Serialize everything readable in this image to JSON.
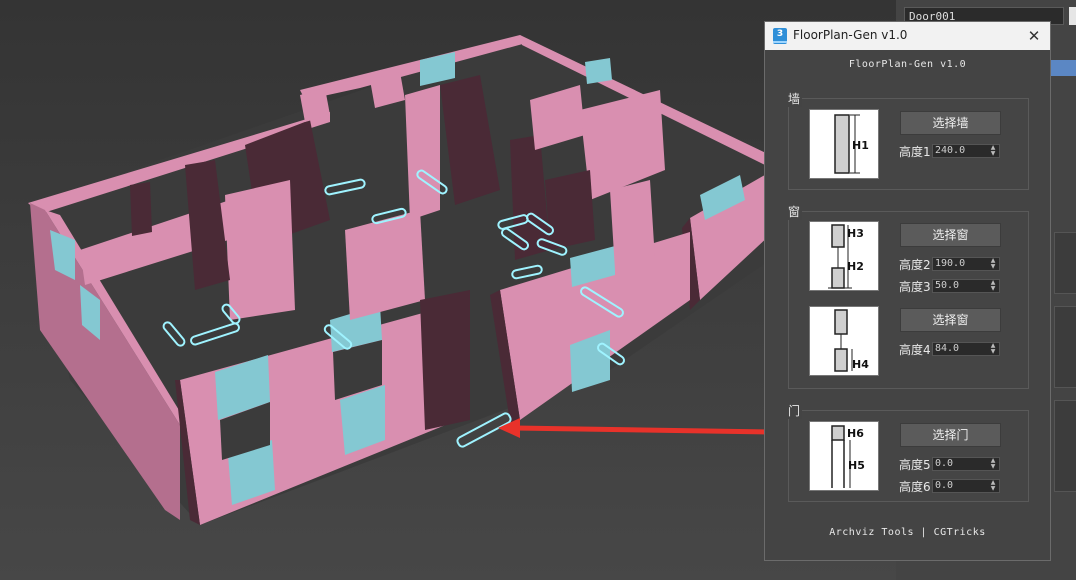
{
  "app": {
    "object_name": "Door001"
  },
  "dialog": {
    "title": "FloorPlan-Gen v1.0",
    "close_symbol": "✕",
    "icon_name": "3dsmax-app-icon",
    "header": "FloorPlan-Gen v1.0",
    "footer": "Archviz Tools | CGTricks",
    "wall": {
      "label": "墙",
      "button": "选择墙",
      "height1_label": "高度1",
      "height1_value": "240.0",
      "thumb_label": "H1"
    },
    "window": {
      "label": "窗",
      "button1": "选择窗",
      "height2_label": "高度2",
      "height2_value": "190.0",
      "height3_label": "高度3",
      "height3_value": "50.0",
      "thumb1_labels": [
        "H3",
        "H2"
      ],
      "button2": "选择窗",
      "height4_label": "高度4",
      "height4_value": "84.0",
      "thumb2_label": "H4"
    },
    "door": {
      "label": "门",
      "button": "选择门",
      "height5_label": "高度5",
      "height5_value": "0.0",
      "height6_label": "高度6",
      "height6_value": "0.0",
      "thumb_labels": [
        "H6",
        "H5"
      ]
    }
  },
  "annotation": {
    "highlight_color": "#e8322a",
    "arrow_color": "#e8322a"
  },
  "colors": {
    "wall": "#d98fb0",
    "wall_dark": "#4a2a36",
    "glass": "#84c8d2",
    "selection": "#9ff3ff",
    "viewport_bg": "#3a3a3a"
  }
}
